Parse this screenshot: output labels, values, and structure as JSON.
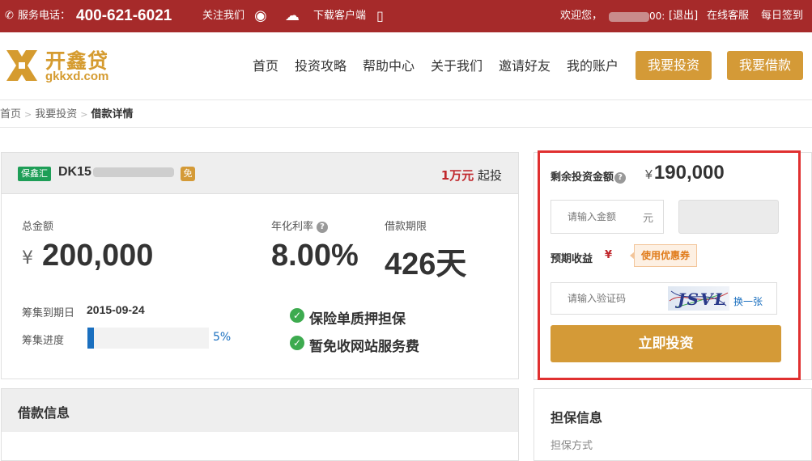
{
  "topbar": {
    "phone_label": "服务电话：",
    "phone_number": "400-621-6021",
    "follow": "关注我们",
    "download": "下载客户端",
    "welcome": "欢迎您，",
    "username_visible": "00:",
    "logout": "[退出]",
    "online_service": "在线客服",
    "daily_checkin": "每日签到"
  },
  "logo": {
    "cn": "开鑫贷",
    "en": "gkkxd.com"
  },
  "nav": {
    "items": [
      "首页",
      "投资攻略",
      "帮助中心",
      "关于我们",
      "邀请好友",
      "我的账户"
    ],
    "invest_button": "我要投资",
    "borrow_button": "我要借款"
  },
  "breadcrumb": {
    "home": "首页",
    "invest": "我要投资",
    "current": "借款详情"
  },
  "loan": {
    "tag": "保鑫汇",
    "id_prefix": "DK15",
    "free_tag": "免",
    "min_invest_amount": "1万元",
    "min_invest_label": "起投",
    "total_label": "总金额",
    "currency": "¥",
    "total_value": "200,000",
    "rate_label": "年化利率",
    "rate_help": "?",
    "rate_value": "8.00%",
    "term_label": "借款期限",
    "term_value": "426天",
    "deadline_label": "筹集到期日",
    "deadline_value": "2015-09-24",
    "progress_label": "筹集进度",
    "progress_value": "5%",
    "progress_fraction": 0.05,
    "features": [
      "保险单质押担保",
      "暂免收网站服务费"
    ]
  },
  "invest": {
    "remaining_label": "剩余投资金额",
    "remaining_help": "?",
    "currency": "¥",
    "remaining_value": "190,000",
    "amount_placeholder": "请输入金额",
    "amount_unit": "元",
    "expected_label": "预期收益",
    "expected_currency": "¥",
    "coupon_label": "使用优惠券",
    "captcha_placeholder": "请输入验证码",
    "captcha_text": "JSVL",
    "refresh_label": "换一张",
    "submit_label": "立即投资"
  },
  "sections": {
    "loan_info": "借款信息",
    "guarantee_info": "担保信息",
    "guarantee_method": "担保方式"
  },
  "colors": {
    "topbar": "#a62a2a",
    "gold": "#d49a37",
    "highlight": "#e03030",
    "progress": "#1a6fbf"
  }
}
